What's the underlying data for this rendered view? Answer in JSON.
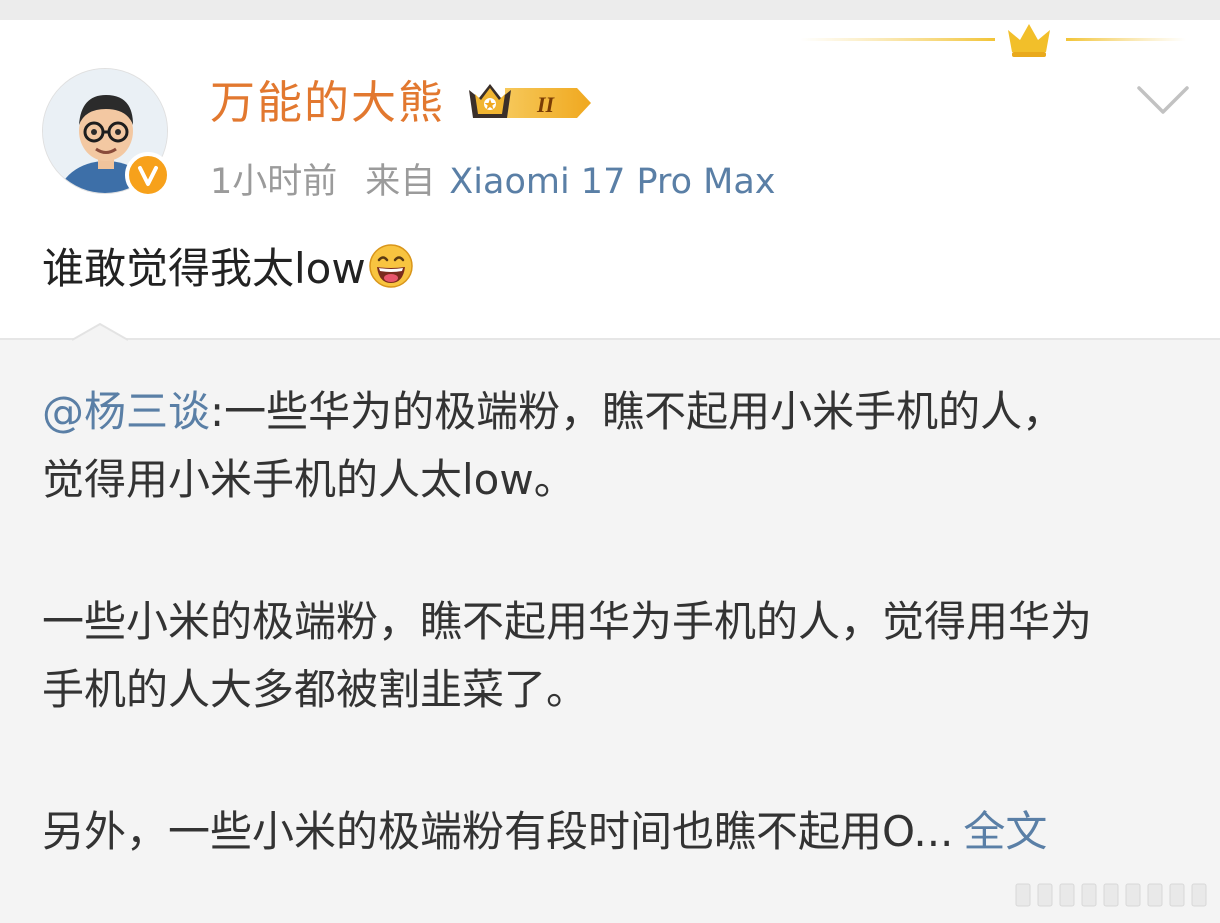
{
  "post": {
    "username": "万能的大熊",
    "vip_level": "II",
    "time": "1小时前",
    "source_prefix": "来自",
    "device": "Xiaomi 17 Pro Max",
    "text": "谁敢觉得我太low",
    "emoji": "laughing-emoji"
  },
  "repost": {
    "mention": "@杨三谈",
    "line1": ":一些华为的极端粉，瞧不起用小米手机的人，",
    "line2": "觉得用小米手机的人太low。",
    "line3": "一些小米的极端粉，瞧不起用华为手机的人，觉得用华为",
    "line4": "手机的人大多都被割韭菜了。",
    "line5": "另外，一些小米的极端粉有段时间也瞧不起用O...",
    "full_text_link": "全文"
  },
  "colors": {
    "username": "#e2782f",
    "link": "#5a7fa6",
    "meta": "#9b9b9b",
    "verified_badge": "#f7a11b",
    "repost_background": "#f4f4f4"
  }
}
